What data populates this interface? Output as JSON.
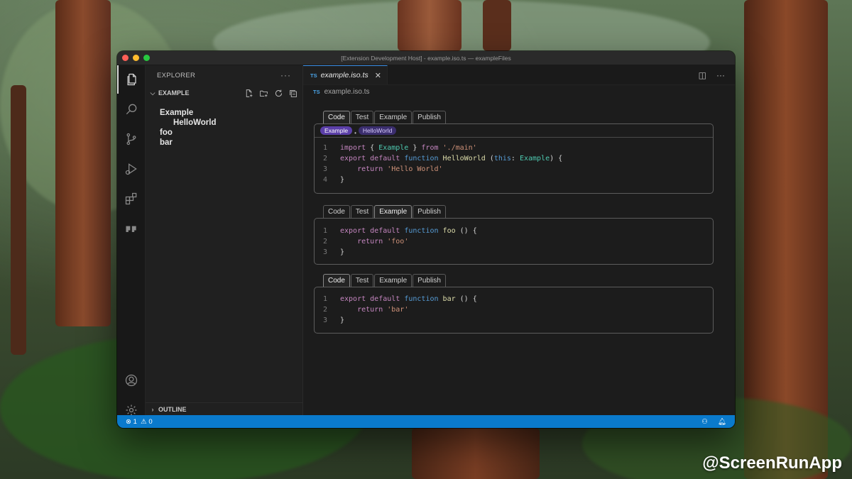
{
  "window": {
    "title": "[Extension Development Host] - example.iso.ts — exampleFiles"
  },
  "sidebar": {
    "header": "EXPLORER",
    "section": "EXAMPLE",
    "tree": [
      "Example",
      "HelloWorld",
      "foo",
      "bar"
    ],
    "outline": "OUTLINE"
  },
  "editor": {
    "tab": {
      "badge": "TS",
      "title": "example.iso.ts"
    },
    "breadcrumb": {
      "badge": "TS",
      "file": "example.iso.ts"
    }
  },
  "blocks": [
    {
      "tabs": [
        "Code",
        "Test",
        "Example",
        "Publish"
      ],
      "active": "Code",
      "pills": [
        "Example",
        "HelloWorld"
      ],
      "lines": [
        {
          "n": "1",
          "text": "import { Example } from './main'"
        },
        {
          "n": "2",
          "text": "export default function HelloWorld (this: Example) {"
        },
        {
          "n": "3",
          "text": "    return 'Hello World'"
        },
        {
          "n": "4",
          "text": "}"
        }
      ]
    },
    {
      "tabs": [
        "Code",
        "Test",
        "Example",
        "Publish"
      ],
      "active": "Example",
      "lines": [
        {
          "n": "1",
          "text": "export default function foo () {"
        },
        {
          "n": "2",
          "text": "    return 'foo'"
        },
        {
          "n": "3",
          "text": "}"
        }
      ]
    },
    {
      "tabs": [
        "Code",
        "Test",
        "Example",
        "Publish"
      ],
      "active": "Code",
      "lines": [
        {
          "n": "1",
          "text": "export default function bar () {"
        },
        {
          "n": "2",
          "text": "    return 'bar'"
        },
        {
          "n": "3",
          "text": "}"
        }
      ]
    }
  ],
  "status": {
    "errors": "1",
    "warnings": "0"
  },
  "watermark": "@ScreenRunApp",
  "colors": {
    "statusbar": "#0a7acc",
    "pill": "#5b3fa8",
    "tab_accent": "#3a8ee6"
  }
}
